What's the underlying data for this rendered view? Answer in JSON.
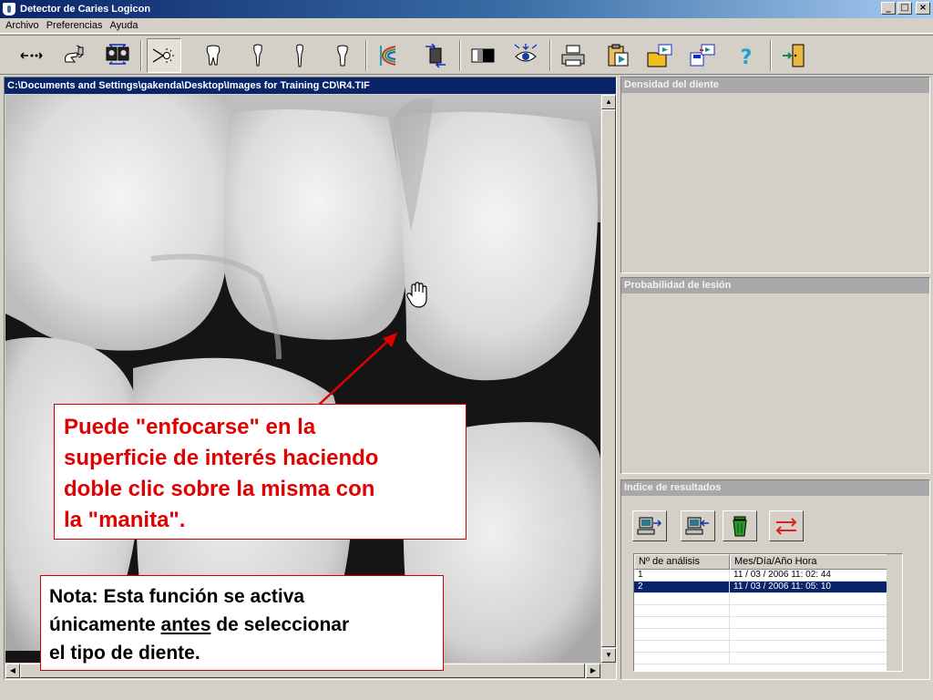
{
  "window": {
    "title": "Detector de Caries Logicon",
    "controls": [
      "_",
      "□",
      "×"
    ]
  },
  "menubar": {
    "items": [
      "Archivo",
      "Preferencias",
      "Ayuda"
    ]
  },
  "toolbar": {
    "buttons": [
      {
        "name": "arrows-expand-icon"
      },
      {
        "name": "hand-probe-icon"
      },
      {
        "name": "compare-images-icon"
      },
      {
        "name": "light-source-icon"
      },
      {
        "name": "tooth-molar-icon"
      },
      {
        "name": "tooth-incisor-icon"
      },
      {
        "name": "tooth-canine-icon"
      },
      {
        "name": "tooth-premolar-icon"
      },
      {
        "name": "rainbow-scan-icon"
      },
      {
        "name": "rotate-image-icon"
      },
      {
        "name": "contrast-icon"
      },
      {
        "name": "eye-zoom-icon"
      },
      {
        "name": "printer-icon"
      },
      {
        "name": "clipboard-play-icon"
      },
      {
        "name": "open-folder-icon"
      },
      {
        "name": "save-file-icon"
      },
      {
        "name": "help-icon"
      },
      {
        "name": "exit-door-icon"
      }
    ]
  },
  "image_window": {
    "path": "C:\\Documents and Settings\\gakenda\\Desktop\\Images for Training CD\\R4.TIF"
  },
  "panels": {
    "density": {
      "title": "Densidad del diente"
    },
    "probability": {
      "title": "Probabilidad de lesión"
    },
    "results": {
      "title": "Indice de resultados",
      "columns": [
        "Nº de análisis",
        "Mes/Día/Año  Hora"
      ],
      "rows": [
        {
          "id": "1",
          "datetime": "11 / 03 / 2006   11: 02: 44",
          "selected": false
        },
        {
          "id": "2",
          "datetime": "11 / 03 / 2006   11: 05: 10",
          "selected": true
        }
      ]
    }
  },
  "callouts": {
    "focus_tip": {
      "line1": "Puede \"enfocarse\" en la",
      "line2": "superficie de interés haciendo",
      "line3": "doble clic sobre la misma con",
      "line4": "la \"manita\"."
    },
    "note": {
      "line1": "Nota: Esta función se activa",
      "line2a": "únicamente ",
      "line2b": "antes",
      "line2c": " de seleccionar",
      "line3": "el tipo de diente."
    }
  },
  "colors": {
    "title_bar": "#0a246a",
    "selection": "#0a246a",
    "callout_red": "#e00000",
    "panel_header": "#a8a8a8",
    "window_face": "#d4d0c8"
  }
}
